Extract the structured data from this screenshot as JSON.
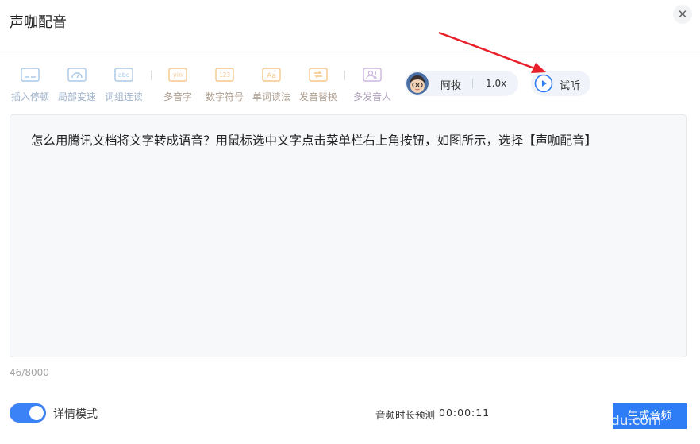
{
  "dialog": {
    "title": "声咖配音",
    "close_glyph": "✕"
  },
  "toolbar": {
    "items": [
      {
        "label": "插入停顿",
        "icon": "pause-insert-icon",
        "color": "#a8c8e8"
      },
      {
        "label": "局部变速",
        "icon": "speed-gauge-icon",
        "color": "#a8c8e8"
      },
      {
        "label": "词组连读",
        "icon": "abc-icon",
        "icon_text": "abc",
        "color": "#a8c8e8"
      },
      {
        "label": "多音字",
        "icon": "yin-icon",
        "icon_text": "yin",
        "color": "#f5c78a"
      },
      {
        "label": "数字符号",
        "icon": "number-123-icon",
        "icon_text": "123",
        "color": "#f5c78a"
      },
      {
        "label": "单词读法",
        "icon": "word-aa-icon",
        "icon_text": "Aa",
        "color": "#f5c78a"
      },
      {
        "label": "发音替换",
        "icon": "replace-icon",
        "color": "#f5c78a"
      },
      {
        "label": "多发音人",
        "icon": "multi-speaker-icon",
        "color": "#cdb5e0"
      }
    ]
  },
  "voice": {
    "name": "阿牧",
    "speed": "1.0x"
  },
  "preview": {
    "label": "试听"
  },
  "editor": {
    "text": "怎么用腾讯文档将文字转成语音？用鼠标选中文字点击菜单栏右上角按钮，如图所示，选择【声咖配音】"
  },
  "footer": {
    "char_count": "46/8000",
    "detail_mode_label": "详情模式",
    "detail_mode_on": true,
    "duration_label": "音频时长预测",
    "duration_value": "00:00:11",
    "generate_label": "生成音频",
    "watermark": "du.com"
  },
  "colors": {
    "accent": "#2e7cf6",
    "toggle": "#3a82f5",
    "arrow": "#e8202a"
  }
}
